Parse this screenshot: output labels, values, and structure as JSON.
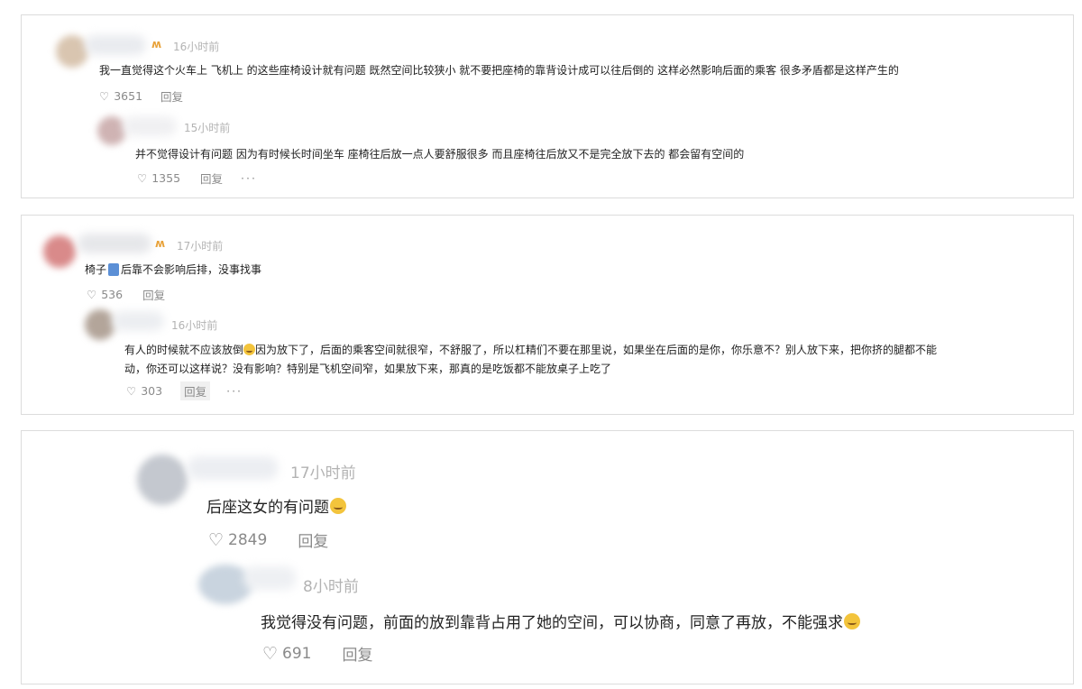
{
  "comments": [
    {
      "time": "16小时前",
      "text": "我一直觉得这个火车上 飞机上 的这些座椅设计就有问题 既然空间比较狭小 就不要把座椅的靠背设计成可以往后倒的 这样必然影响后面的乘客 很多矛盾都是这样产生的",
      "likes": "3651",
      "reply_label": "回复",
      "reply": {
        "time": "15小时前",
        "text": "并不觉得设计有问题 因为有时候长时间坐车 座椅往后放一点人要舒服很多 而且座椅往后放又不是完全放下去的 都会留有空间的",
        "likes": "1355",
        "reply_label": "回复",
        "more": "···"
      }
    },
    {
      "time": "17小时前",
      "text_before": "椅子",
      "text_after": "后靠不会影响后排，没事找事",
      "likes": "536",
      "reply_label": "回复",
      "reply": {
        "time": "16小时前",
        "text_part1": "有人的时候就不应该放倒",
        "text_part2": "因为放下了，后面的乘客空间就很窄，不舒服了，所以杠精们不要在那里说，如果坐在后面的是你，你乐意不？别人放下来，把你挤的腿都不能",
        "text_line2": "动，你还可以这样说？没有影响？特别是飞机空间窄，如果放下来，那真的是吃饭都不能放桌子上吃了",
        "likes": "303",
        "reply_label": "回复",
        "more": "···"
      }
    },
    {
      "time": "17小时前",
      "text": "后座这女的有问题",
      "likes": "2849",
      "reply_label": "回复",
      "reply": {
        "time": "8小时前",
        "text": "我觉得没有问题，前面的放到靠背占用了她的空间，可以协商，同意了再放，不能强求",
        "likes": "691",
        "reply_label": "回复"
      }
    }
  ],
  "icons": {
    "heart": "heart-outline-icon",
    "badge": "vip-badge-icon",
    "emoji": "laughing-emoji-icon",
    "chair": "chair-emoji-icon",
    "shocked": "shocked-emoji-icon"
  },
  "colors": {
    "badge": "#e8a23a",
    "time": "#b3b3b3",
    "action": "#8a8a8a",
    "border": "#dcdcdc"
  }
}
